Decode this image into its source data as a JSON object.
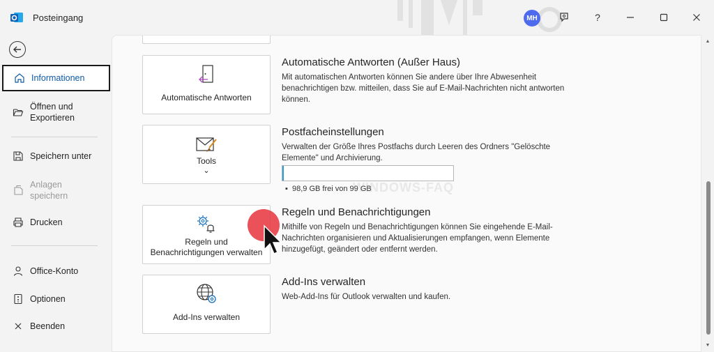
{
  "titlebar": {
    "title": "Posteingang",
    "avatar_initials": "MH",
    "help_label": "?"
  },
  "sidebar": {
    "items": [
      {
        "label": "Informationen",
        "icon": "home-icon"
      },
      {
        "label": "Öffnen und\nExportieren",
        "icon": "folder-open-icon"
      },
      {
        "label": "Speichern unter",
        "icon": "save-as-icon"
      },
      {
        "label": "Anlagen\nspeichern",
        "icon": "save-attachments-icon"
      },
      {
        "label": "Drucken",
        "icon": "printer-icon"
      },
      {
        "label": "Office-Konto",
        "icon": "person-icon"
      },
      {
        "label": "Optionen",
        "icon": "options-icon"
      },
      {
        "label": "Beenden",
        "icon": "close-icon"
      }
    ]
  },
  "sections": {
    "auto_reply": {
      "card_label": "Automatische Antworten",
      "title": "Automatische Antworten (Außer Haus)",
      "desc": "Mit automatischen Antworten können Sie andere über Ihre Abwesenheit benachrichtigen bzw. mitteilen, dass Sie auf E-Mail-Nachrichten nicht antworten können."
    },
    "mailbox": {
      "card_label": "Tools",
      "card_caret": "⌄",
      "title": "Postfacheinstellungen",
      "desc": "Verwalten der Größe Ihres Postfachs durch Leeren des Ordners \"Gelöschte Elemente\" und Archivierung.",
      "quota": "98,9 GB frei von 99 GB",
      "quota_used_fraction": 0.01
    },
    "rules": {
      "card_label": "Regeln und\nBenachrichtigungen verwalten",
      "title": "Regeln und Benachrichtigungen",
      "desc": "Mithilfe von Regeln und Benachrichtigungen können Sie eingehende E-Mail-Nachrichten organisieren und Aktualisierungen empfangen, wenn Elemente hinzugefügt, geändert oder entfernt werden."
    },
    "addins": {
      "card_label": "Add-Ins verwalten",
      "title": "Add-Ins verwalten",
      "desc": "Web-Add-Ins für Outlook verwalten und kaufen."
    }
  },
  "watermark": "WINDOWS-FAQ",
  "colors": {
    "accent": "#0f5aa8",
    "progress": "#2b9fd6",
    "avatar": "#4f6bed",
    "click_marker": "#e6323c"
  }
}
